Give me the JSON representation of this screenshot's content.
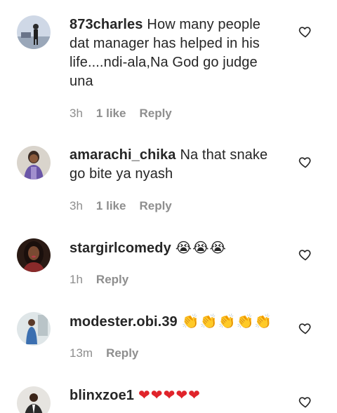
{
  "comments": [
    {
      "username": "873charles",
      "text": "How many people dat manager has helped in his life....ndi-ala,Na God go judge una",
      "time": "3h",
      "likes": "1 like",
      "reply": "Reply"
    },
    {
      "username": "amarachi_chika",
      "text": "Na that snake go bite ya nyash",
      "time": "3h",
      "likes": "1 like",
      "reply": "Reply"
    },
    {
      "username": "stargirlcomedy",
      "text": "😭😭😭",
      "time": "1h",
      "reply": "Reply"
    },
    {
      "username": "modester.obi.39",
      "text": "👏👏👏👏👏",
      "time": "13m",
      "reply": "Reply"
    },
    {
      "username": "blinxzoe1",
      "text": "❤❤❤❤❤"
    }
  ],
  "icons": {
    "like": "heart-outline-icon"
  }
}
